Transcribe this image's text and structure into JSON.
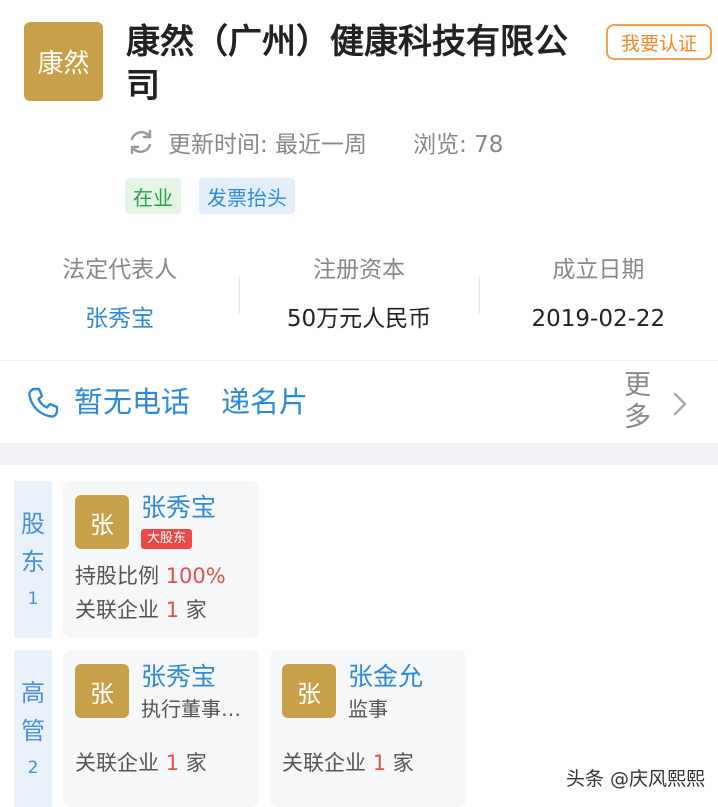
{
  "header": {
    "logo_text": "康然",
    "company_name": "康然（广州）健康科技有限公司",
    "verify_label": "我要认证",
    "update_label": "更新时间: 最近一周",
    "views_label": "浏览: 78",
    "tags": [
      "在业",
      "发票抬头"
    ]
  },
  "info": {
    "legal_rep_label": "法定代表人",
    "legal_rep_value": "张秀宝",
    "capital_label": "注册资本",
    "capital_value": "50万元人民币",
    "date_label": "成立日期",
    "date_value": "2019-02-22"
  },
  "contact": {
    "phone_text": "暂无电话",
    "card_text": "递名片",
    "more_text": "更多"
  },
  "shareholders": {
    "label": "股东",
    "count": "1",
    "items": [
      {
        "avatar": "张",
        "name": "张秀宝",
        "badge": "大股东",
        "ratio_label": "持股比例",
        "ratio_value": "100%",
        "related_prefix": "关联企业",
        "related_count": "1",
        "related_suffix": "家"
      }
    ]
  },
  "executives": {
    "label": "高管",
    "count": "2",
    "items": [
      {
        "avatar": "张",
        "name": "张秀宝",
        "role": "执行董事兼总经理",
        "related_prefix": "关联企业",
        "related_count": "1",
        "related_suffix": "家"
      },
      {
        "avatar": "张",
        "name": "张金允",
        "role": "监事",
        "related_prefix": "关联企业",
        "related_count": "1",
        "related_suffix": "家"
      }
    ]
  },
  "watermark": "头条 @庆风熙熙",
  "colors": {
    "accent_blue": "#2f8ad6",
    "gold": "#c9a04a",
    "verify_orange": "#f08a2a",
    "status_green": "#26a04a",
    "red": "#e0524a"
  },
  "icons": [
    "refresh-icon",
    "phone-icon",
    "chevron-right-icon"
  ]
}
